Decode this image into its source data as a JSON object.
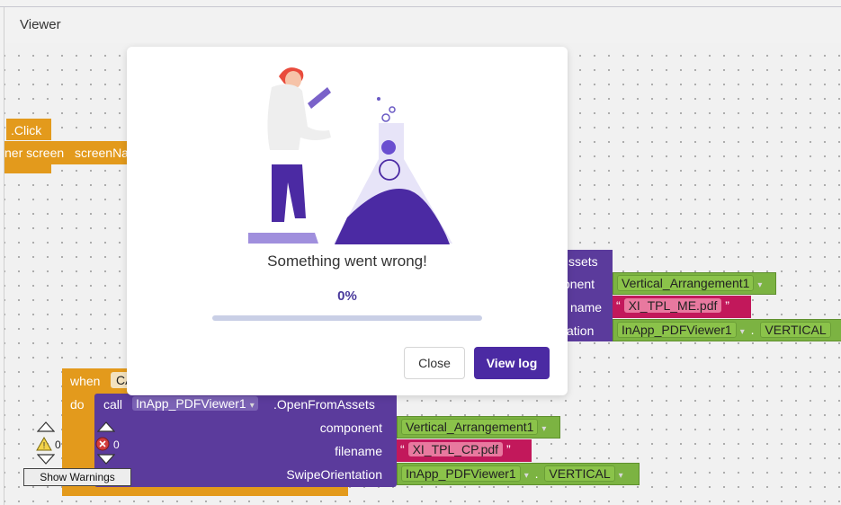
{
  "viewer": {
    "title": "Viewer"
  },
  "blocks": {
    "click_label": ".Click",
    "other_screen": "ner screen",
    "screen_name": "screenNa",
    "assets_tail": "ssets",
    "component_tail": "onent",
    "filename_tail": "name",
    "orientation_tail": "ation",
    "top_arrangement": "Vertical_Arrangement1",
    "top_pdf_filename": "XI_TPL_ME.pdf",
    "top_viewer_ref": "InApp_PDFViewer1",
    "top_vertical": "VERTICAL",
    "when_label": "when",
    "when_comp": "CA",
    "do_label": "do",
    "call_label": "call",
    "call_component": "InApp_PDFViewer1",
    "call_method": ".OpenFromAssets",
    "param_component": "component",
    "param_filename": "filename",
    "param_swipe": "SwipeOrientation",
    "arrangement_value": "Vertical_Arrangement1",
    "pdf_filename": "XI_TPL_CP.pdf",
    "viewer_ref": "InApp_PDFViewer1",
    "vertical_value": "VERTICAL",
    "quote_open": "“",
    "quote_close": "”",
    "dot": "."
  },
  "warnings": {
    "warning_count": "0",
    "error_count": "0",
    "show_warnings_label": "Show Warnings"
  },
  "modal": {
    "message": "Something went wrong!",
    "percent_label": "0%",
    "progress_fraction": 0.0,
    "close_label": "Close",
    "view_log_label": "View log"
  },
  "colors": {
    "accent": "#4b2aa3",
    "block_orange": "#e39a1c",
    "block_purple": "#5b3b9c",
    "block_green": "#7cb342",
    "block_pink": "#c2185b"
  }
}
